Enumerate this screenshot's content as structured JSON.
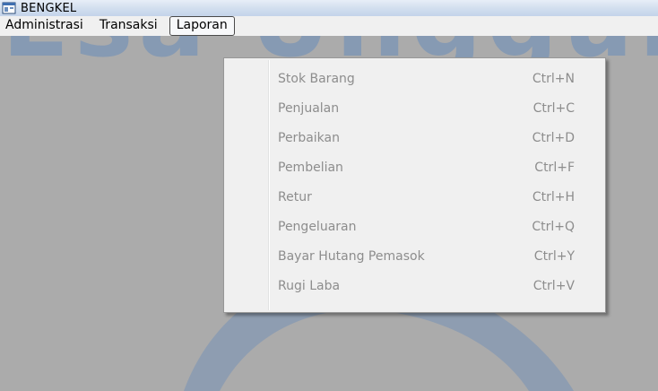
{
  "window": {
    "title": "BENGKEL",
    "icon": "app-window-icon"
  },
  "menubar": {
    "items": [
      {
        "label": "Administrasi"
      },
      {
        "label": "Transaksi"
      },
      {
        "label": "Laporan",
        "active": true
      }
    ]
  },
  "watermark": {
    "text": "Esa Unggul",
    "color": "#286ec8"
  },
  "dropdown": {
    "menu": "Laporan",
    "items": [
      {
        "label": "Stok Barang",
        "shortcut": "Ctrl+N",
        "enabled": false
      },
      {
        "label": "Penjualan",
        "shortcut": "Ctrl+C",
        "enabled": false
      },
      {
        "label": "Perbaikan",
        "shortcut": "Ctrl+D",
        "enabled": false
      },
      {
        "label": "Pembelian",
        "shortcut": "Ctrl+F",
        "enabled": false
      },
      {
        "label": "Retur",
        "shortcut": "Ctrl+H",
        "enabled": false
      },
      {
        "label": "Pengeluaran",
        "shortcut": "Ctrl+Q",
        "enabled": false
      },
      {
        "label": "Bayar Hutang Pemasok",
        "shortcut": "Ctrl+Y",
        "enabled": false
      },
      {
        "label": "Rugi Laba",
        "shortcut": "Ctrl+V",
        "enabled": false
      }
    ]
  },
  "colors": {
    "client_background": "#ababab",
    "menu_background": "#f0f0f0",
    "disabled_text": "#8d8d8d"
  }
}
